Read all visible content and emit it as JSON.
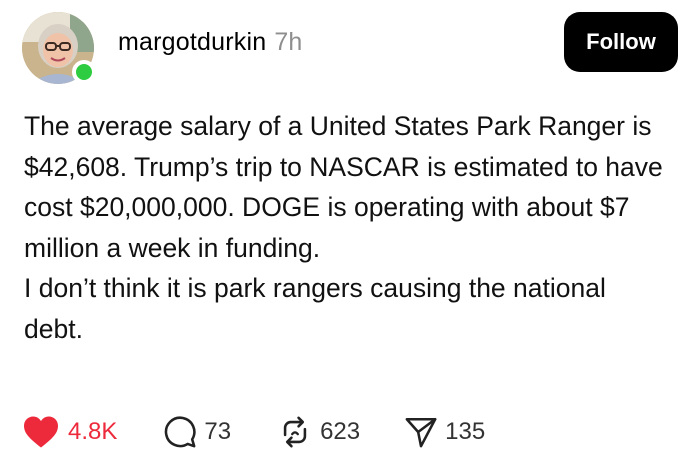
{
  "post": {
    "author": {
      "username": "margotdurkin",
      "timestamp": "7h",
      "online": true
    },
    "follow_label": "Follow",
    "text_lines": [
      "The average salary of a United States Park Ranger is $42,608. Trump’s trip to NASCAR is estimated to have cost $20,000,000.  DOGE is operating with about $7 million a week in funding.",
      "I don’t think it is park rangers causing the national debt."
    ],
    "stats": {
      "likes": "4.8K",
      "comments": "73",
      "reposts": "623",
      "shares": "135"
    },
    "colors": {
      "like": "#ed2a3b",
      "online": "#2ecc40",
      "follow_bg": "#000000"
    },
    "icons": {
      "like": "heart-icon",
      "comment": "comment-bubble-icon",
      "repost": "repost-arrows-icon",
      "share": "send-plane-icon"
    }
  }
}
